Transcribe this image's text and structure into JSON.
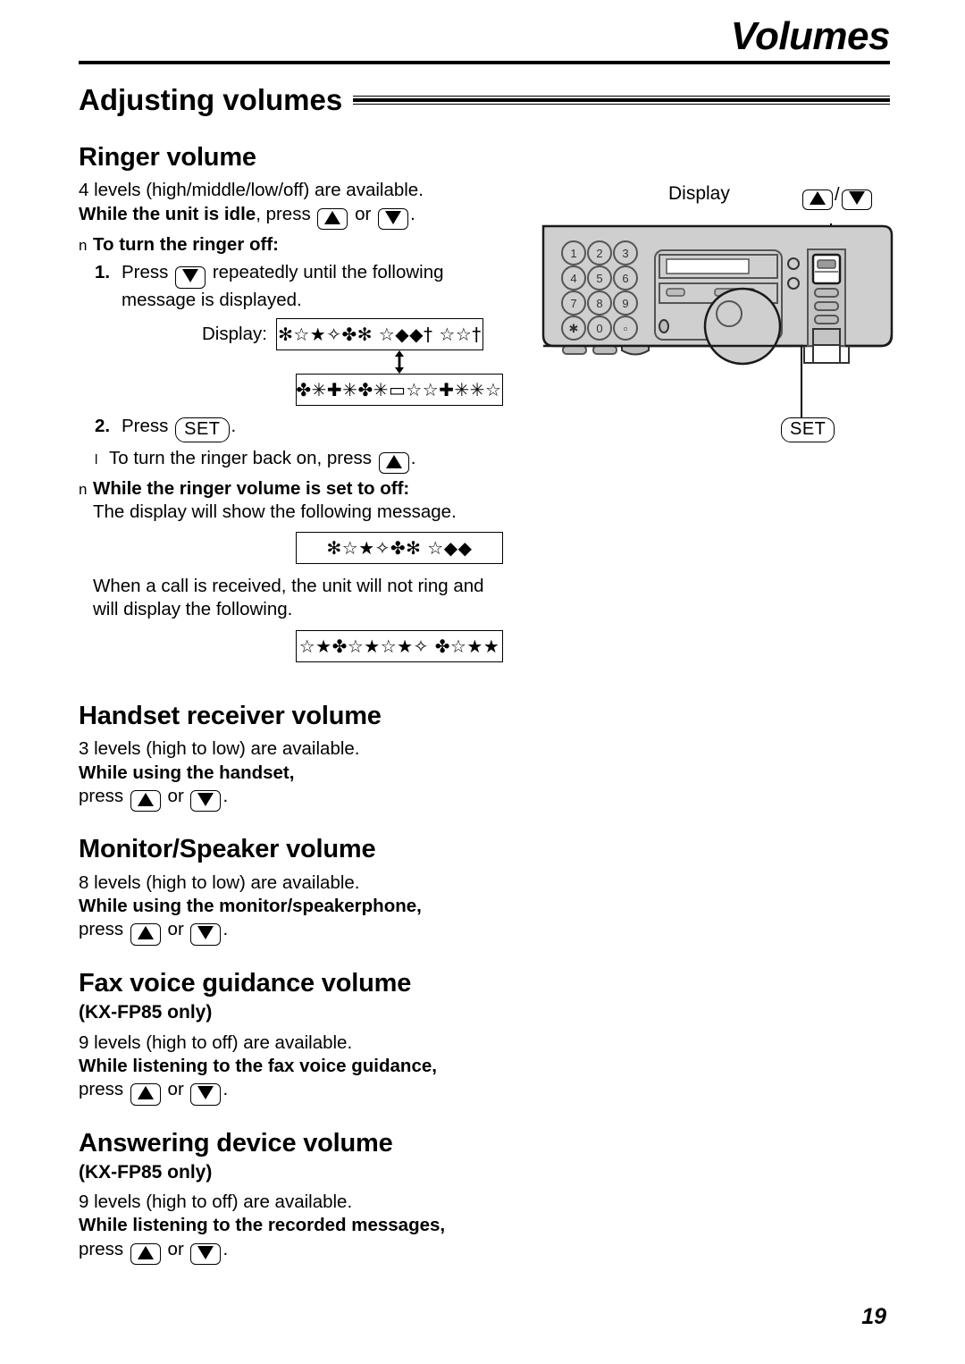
{
  "header": {
    "chapter_title": "Volumes",
    "section_title": "Adjusting volumes"
  },
  "page_number": "19",
  "bullet_glyph_square": "n",
  "bullet_glyph_dash": "l",
  "keys": {
    "up_label": "up-arrow-key",
    "down_label": "down-arrow-key",
    "set_label": "SET",
    "slash": "/"
  },
  "sections": [
    {
      "id": "ringer-volume",
      "heading": "Ringer volume",
      "levels_line": "4 levels (high/middle/low/off) are available.",
      "condition_bold": "While the unit is idle",
      "condition_rest": ", press",
      "condition_or": "or",
      "condition_end": ".",
      "bullet_1": "To turn the ringer off:",
      "step_1_num": "1.",
      "step_1_pre": "Press",
      "step_1_post": "repeatedly until the following",
      "step_1_line2": "message is displayed.",
      "display_label": "Display:",
      "lcd_1": "✻☆★✧✤✻ ☆◆◆† ☆☆†",
      "lcd_2": "✷✤✳✚✳✤✳▭☆☆✚✳✳☆☆",
      "step_2_num": "2.",
      "step_2_pre": "Press",
      "step_2_post": ".",
      "sub_bullet": "To turn the ringer back on, press",
      "sub_bullet_end": ".",
      "bullet_2": "While the ringer volume is set to off:",
      "para_1": "The display will show the following message.",
      "lcd_3": "✻☆★✧✤✻ ☆◆◆",
      "para_2_line1": "When a call is received, the unit will not ring and",
      "para_2_line2": "will display the following.",
      "lcd_4": "☆★✤☆★☆★✧ ✤☆★★"
    },
    {
      "id": "handset-receiver-volume",
      "heading": "Handset receiver volume",
      "levels_line": "3 levels (high to low) are available.",
      "condition_bold": "While using the handset,",
      "press_word": "press",
      "or_word": "or",
      "end_word": "."
    },
    {
      "id": "monitor-speaker-volume",
      "heading": "Monitor/Speaker volume",
      "levels_line": "8 levels (high to low) are available.",
      "condition_bold": "While using the monitor/speakerphone,",
      "press_word": "press",
      "or_word": "or",
      "end_word": "."
    },
    {
      "id": "fax-voice-guidance-volume",
      "heading": "Fax voice guidance volume",
      "model_note": "(KX-FP85 only)",
      "levels_line": "9 levels (high to off) are available.",
      "condition_bold": "While listening to the fax voice guidance,",
      "press_word": "press",
      "or_word": "or",
      "end_word": "."
    },
    {
      "id": "answering-device-volume",
      "heading": "Answering device volume",
      "model_note": "(KX-FP85 only)",
      "levels_line": "9 levels (high to off) are available.",
      "condition_bold": "While listening to the recorded messages,",
      "press_word": "press",
      "or_word": "or",
      "end_word": "."
    }
  ],
  "diagram": {
    "display_callout": "Display",
    "set_callout": "SET",
    "updown_slash": "/",
    "keypad": [
      "1",
      "2",
      "3",
      "4",
      "5",
      "6",
      "7",
      "8",
      "9",
      "✱",
      "0",
      "▫"
    ]
  }
}
